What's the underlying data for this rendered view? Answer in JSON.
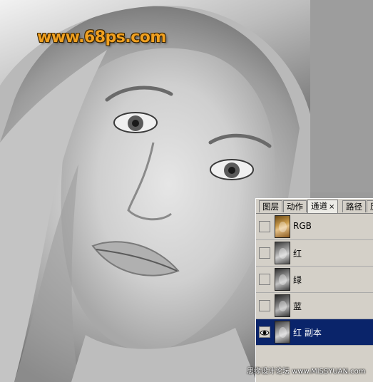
{
  "watermark": "www.68ps.com",
  "panel": {
    "tabs": [
      {
        "label": "图层"
      },
      {
        "label": "动作"
      },
      {
        "label": "通道",
        "close": "×"
      },
      {
        "label": "路径"
      },
      {
        "label": "历"
      }
    ],
    "channels": [
      {
        "name": "RGB",
        "visible": false,
        "selected": false,
        "thumbnail": "color"
      },
      {
        "name": "红",
        "visible": false,
        "selected": false,
        "thumbnail": "gray"
      },
      {
        "name": "绿",
        "visible": false,
        "selected": false,
        "thumbnail": "gray"
      },
      {
        "name": "蓝",
        "visible": false,
        "selected": false,
        "thumbnail": "gray"
      },
      {
        "name": "红 副本",
        "visible": true,
        "selected": true,
        "thumbnail": "gray"
      }
    ]
  },
  "credit": "思缘设计论坛  www.MISSYUAN.com",
  "icons": {
    "eye": "eye-icon",
    "close": "close-icon"
  },
  "colors": {
    "selected_row": "#0a246a",
    "watermark": "#f0a020",
    "panel_bg": "#d4d0c8"
  }
}
